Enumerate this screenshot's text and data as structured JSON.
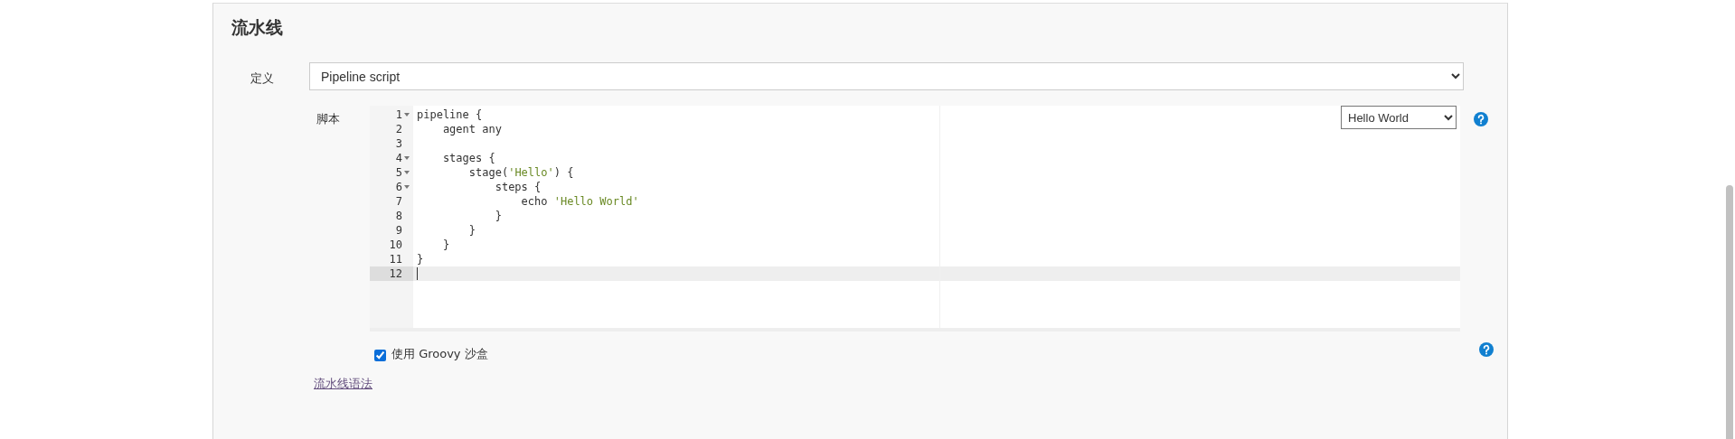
{
  "section": {
    "title": "流水线"
  },
  "definition": {
    "label": "定义",
    "value": "Pipeline script"
  },
  "script": {
    "label": "脚本",
    "template": "Hello World",
    "lines": [
      {
        "number": "1",
        "foldable": true,
        "active": false,
        "tokens": [
          {
            "kind": "plain",
            "text": "pipeline {"
          }
        ]
      },
      {
        "number": "2",
        "foldable": false,
        "active": false,
        "tokens": [
          {
            "kind": "plain",
            "text": "    agent any"
          }
        ]
      },
      {
        "number": "3",
        "foldable": false,
        "active": false
      },
      {
        "number": "4",
        "foldable": true,
        "active": false,
        "tokens": [
          {
            "kind": "plain",
            "text": "    stages {"
          }
        ]
      },
      {
        "number": "5",
        "foldable": true,
        "active": false,
        "tokens": [
          {
            "kind": "plain",
            "text": "        stage("
          },
          {
            "kind": "string",
            "text": "'Hello'"
          },
          {
            "kind": "plain",
            "text": ") {"
          }
        ]
      },
      {
        "number": "6",
        "foldable": true,
        "active": false,
        "tokens": [
          {
            "kind": "plain",
            "text": "            steps {"
          }
        ]
      },
      {
        "number": "7",
        "foldable": false,
        "active": false,
        "tokens": [
          {
            "kind": "plain",
            "text": "                echo "
          },
          {
            "kind": "string",
            "text": "'Hello World'"
          }
        ]
      },
      {
        "number": "8",
        "foldable": false,
        "active": false,
        "tokens": [
          {
            "kind": "plain",
            "text": "            }"
          }
        ]
      },
      {
        "number": "9",
        "foldable": false,
        "active": false,
        "tokens": [
          {
            "kind": "plain",
            "text": "        }"
          }
        ]
      },
      {
        "number": "10",
        "foldable": false,
        "active": false,
        "tokens": [
          {
            "kind": "plain",
            "text": "    }"
          }
        ]
      },
      {
        "number": "11",
        "foldable": false,
        "active": false,
        "tokens": [
          {
            "kind": "plain",
            "text": "}"
          }
        ]
      },
      {
        "number": "12",
        "foldable": false,
        "active": true
      }
    ]
  },
  "sandbox": {
    "label": "使用 Groovy 沙盒",
    "checked": true
  },
  "syntax_link": "流水线语法"
}
